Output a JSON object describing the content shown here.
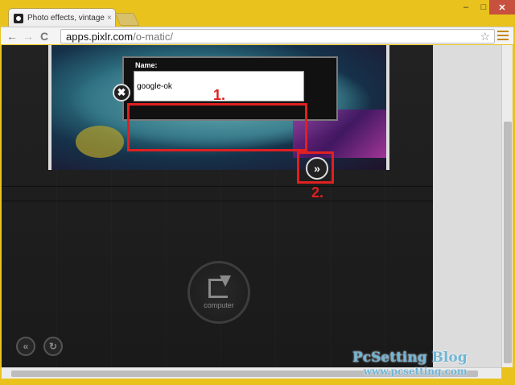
{
  "browser": {
    "tab_title": "Photo effects, vintage, rc",
    "tab_close": "×",
    "url_host": "apps.pixlr.com",
    "url_path": "/o-matic/",
    "back_label": "←",
    "forward_label": "→",
    "reload_label": "C",
    "star_label": "☆",
    "win_min": "–",
    "win_max": "□",
    "win_close": "✕"
  },
  "dialog": {
    "field_label": "Name:",
    "field_value": "google-ok",
    "close_label": "✖",
    "next_label": "»"
  },
  "annotations": {
    "marker1": "1.",
    "marker2": "2.",
    "color": "#e02020"
  },
  "upload": {
    "computer_label": "computer"
  },
  "controls": {
    "back_label": "«",
    "refresh_label": "↻"
  },
  "watermark": {
    "title": "PcSetting Blog",
    "url": "www.pcsetting.com"
  }
}
